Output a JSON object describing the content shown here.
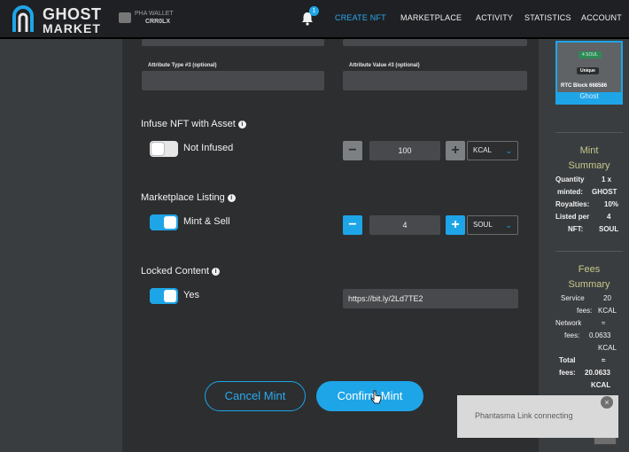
{
  "header": {
    "logo_line1": "GHOST",
    "logo_line2": "MARKET",
    "wallet_label": "PHA WALLET",
    "wallet_address": "CRR0LX",
    "notification_count": "1",
    "nav": [
      "CREATE NFT",
      "MARKETPLACE",
      "ACTIVITY",
      "STATISTICS",
      "ACCOUNT"
    ],
    "active_nav": "CREATE NFT"
  },
  "form": {
    "attr_type_label": "Attribute Type #3 (optional)",
    "attr_value_label": "Attribute Value #3 (optional)",
    "infuse": {
      "title": "Infuse NFT with Asset",
      "toggle_label": "Not Infused",
      "toggle_on": false,
      "amount": "100",
      "token": "KCAL"
    },
    "listing": {
      "title": "Marketplace Listing",
      "toggle_label": "Mint & Sell",
      "toggle_on": true,
      "amount": "4",
      "token": "SOUL"
    },
    "locked": {
      "title": "Locked Content",
      "toggle_label": "Yes",
      "toggle_on": true,
      "url": "https://bit.ly/2Ld7TE2"
    },
    "cancel_label": "Cancel Mint",
    "confirm_label": "Confirm Mint"
  },
  "preview_card": {
    "price_pill": "4 SOUL",
    "unique_pill": "Unique",
    "caption": "RTC Block 668586",
    "name": "Ghost"
  },
  "mint_summary": {
    "title1": "Mint",
    "title2": "Summary",
    "rows": [
      [
        "Quantity",
        "1 x"
      ],
      [
        "minted:",
        "GHOST"
      ],
      [
        "Royalties:",
        "10%"
      ],
      [
        "Listed per",
        "4"
      ],
      [
        "NFT:",
        "SOUL"
      ]
    ]
  },
  "fees_summary": {
    "title1": "Fees",
    "title2": "Summary",
    "rows": [
      [
        "Service",
        "20"
      ],
      [
        "fees:",
        "KCAL"
      ],
      [
        "Network",
        "≈"
      ],
      [
        "fees:",
        "0.0633"
      ],
      [
        "",
        "KCAL"
      ],
      [
        "Total",
        "≈"
      ],
      [
        "fees:",
        "20.0633"
      ],
      [
        "",
        "KCAL"
      ]
    ]
  },
  "toast": {
    "message": "Phantasma Link connecting",
    "close": "×"
  },
  "colors": {
    "accent": "#1ea5e8",
    "header_bg": "#1f2023",
    "panel_bg": "#2c2e30",
    "summary_title": "#c7c98a"
  }
}
